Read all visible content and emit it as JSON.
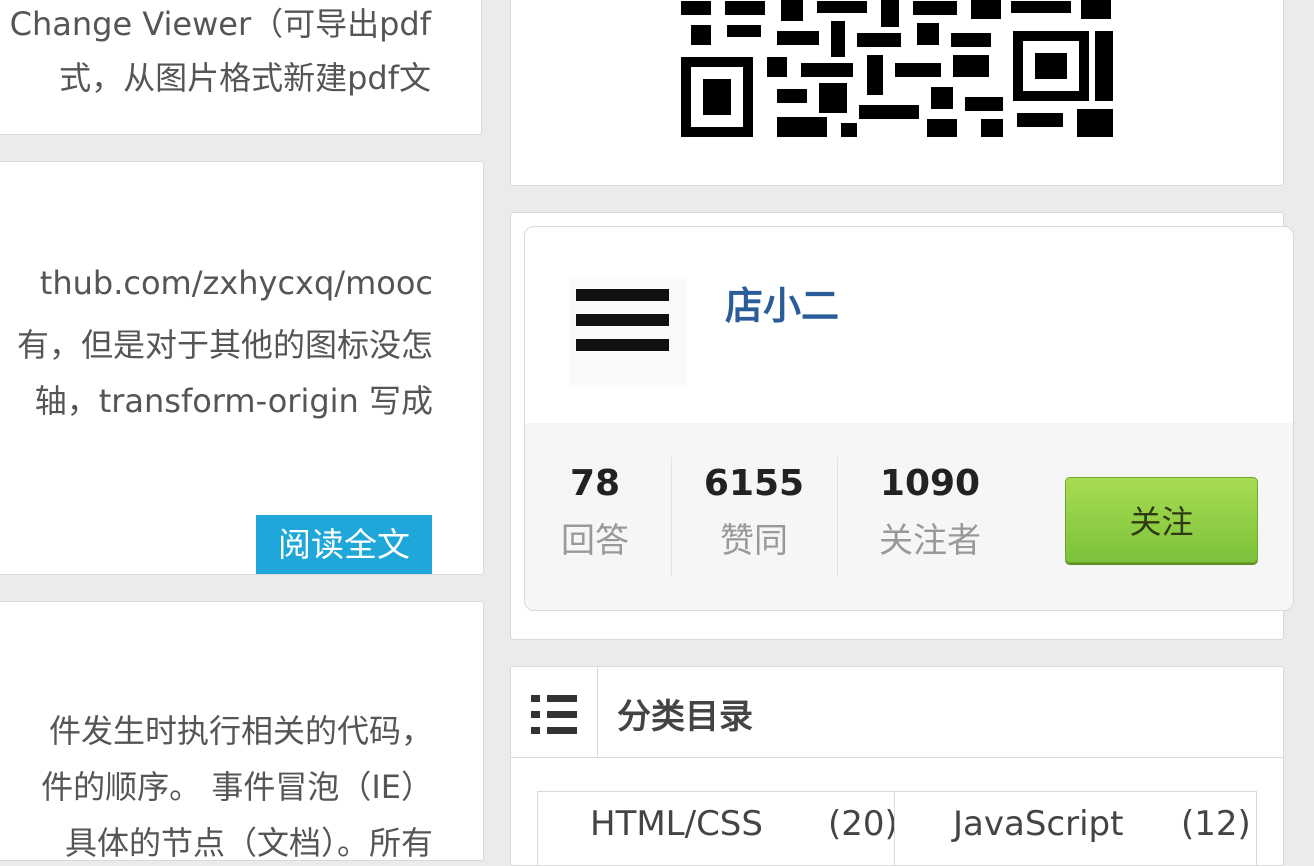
{
  "articles": [
    {
      "lines": [
        "Change Viewer（可导出pdf",
        "式，从图片格式新建pdf文"
      ]
    },
    {
      "lines": [
        "thub.com/zxhycxq/mooc",
        "有，但是对于其他的图标没怎",
        "轴，transform-origin 写成"
      ],
      "read_more": "阅读全文"
    },
    {
      "lines": [
        "件发生时执行相关的代码，",
        "件的顺序。 事件冒泡（IE）",
        "具体的节点（文档）。所有"
      ]
    }
  ],
  "author": {
    "name": "店小二",
    "avatar_icon": "hamburger-icon",
    "stats": [
      {
        "value": "78",
        "label": "回答"
      },
      {
        "value": "6155",
        "label": "赞同"
      },
      {
        "value": "1090",
        "label": "关注者"
      }
    ],
    "follow_label": "关注",
    "follow_color": "#8ccc45"
  },
  "categories": {
    "title": "分类目录",
    "icon": "list-icon",
    "items": [
      {
        "name": "HTML/CSS",
        "count": "(20)"
      },
      {
        "name": "JavaScript",
        "count": "(12)"
      }
    ]
  },
  "colors": {
    "accent": "#1ea7d8",
    "author_name": "#2a5c9a"
  }
}
